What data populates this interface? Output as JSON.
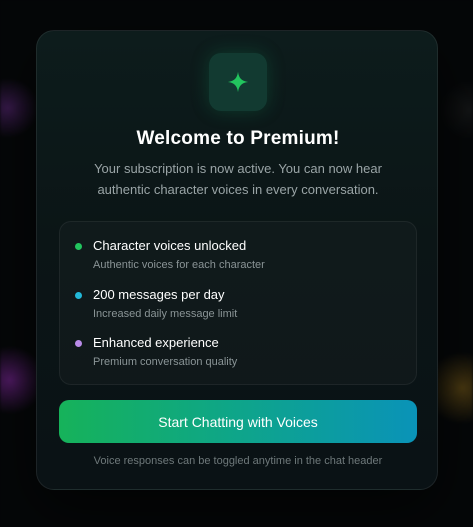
{
  "dialog": {
    "title": "Welcome to Premium!",
    "subtitle": "Your subscription is now active. You can now hear authentic character voices in every conversation.",
    "icon": "sparkle-icon",
    "accent_color": "#22c55e"
  },
  "features": [
    {
      "title": "Character voices unlocked",
      "description": "Authentic voices for each character",
      "dot_color": "#22c55e"
    },
    {
      "title": "200 messages per day",
      "description": "Increased daily message limit",
      "dot_color": "#22b8d8"
    },
    {
      "title": "Enhanced experience",
      "description": "Premium conversation quality",
      "dot_color": "#b98be8"
    }
  ],
  "cta": {
    "label": "Start Chatting with Voices",
    "gradient_start": "#16b25a",
    "gradient_end": "#0a93b8"
  },
  "footnote": "Voice responses can be toggled anytime in the chat header"
}
